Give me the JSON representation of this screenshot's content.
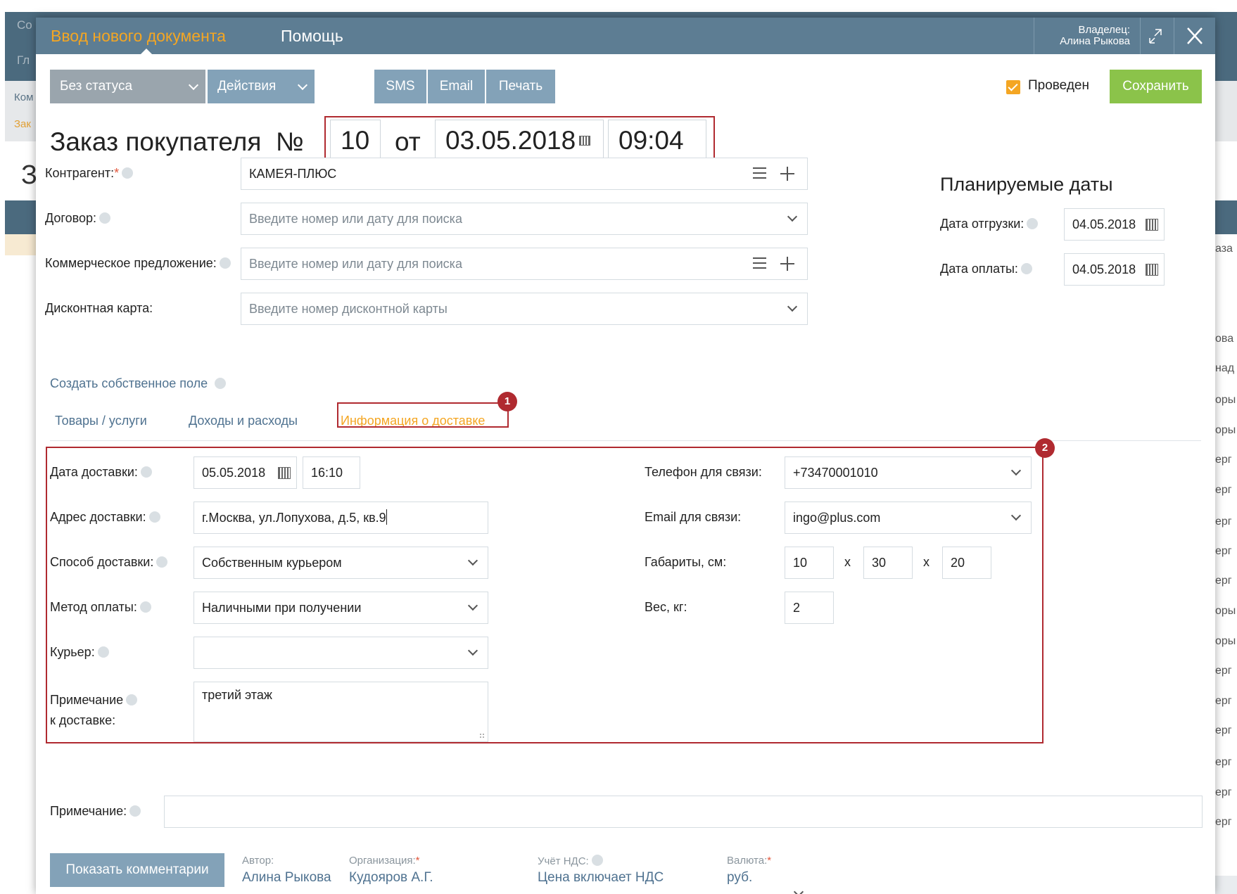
{
  "background": {
    "top_left_text_1": "Co",
    "top_left_text_2": "Гл",
    "sidebar_text_1": "Ком",
    "sidebar_text_2": "Зак",
    "big_letter": "З",
    "right_items": [
      "аза",
      "ова",
      "над",
      "оры",
      "оры",
      "ерг",
      "ерг",
      "ерг",
      "ерг",
      "ерг",
      "оры",
      "оры",
      "ерг",
      "ерг",
      "ерг",
      "ерг",
      "ерг",
      "ерг"
    ]
  },
  "header": {
    "title": "Ввод нового документа",
    "help": "Помощь",
    "owner_label": "Владелец:",
    "owner_name": "Алина Рыкова"
  },
  "toolbar": {
    "status": "Без статуса",
    "actions": "Действия",
    "sms": "SMS",
    "email": "Email",
    "print": "Печать",
    "posted_label": "Проведен",
    "posted_checked": true,
    "save": "Сохранить"
  },
  "document": {
    "title": "Заказ покупателя  №",
    "number": "10",
    "from_label": "от",
    "date": "03.05.2018",
    "time": "09:04"
  },
  "form": {
    "counterparty_label": "Контрагент:",
    "counterparty_value": "КАМЕЯ-ПЛЮС",
    "contract_label": "Договор:",
    "contract_placeholder": "Введите номер или дату для поиска",
    "offer_label": "Коммерческое предложение:",
    "offer_placeholder": "Введите номер или дату для поиска",
    "discount_label": "Дисконтная карта:",
    "discount_placeholder": "Введите номер дисконтной карты",
    "create_field_link": "Создать собственное поле"
  },
  "planned": {
    "title": "Планируемые даты",
    "shipment_label": "Дата отгрузки:",
    "shipment_date": "04.05.2018",
    "payment_label": "Дата оплаты:",
    "payment_date": "04.05.2018"
  },
  "tabs": [
    {
      "label": "Товары / услуги"
    },
    {
      "label": "Доходы и расходы"
    },
    {
      "label": "Информация о доставке",
      "active": true
    }
  ],
  "markers": {
    "first": "1",
    "second": "2"
  },
  "delivery": {
    "date_label": "Дата доставки:",
    "date": "05.05.2018",
    "time": "16:10",
    "address_label": "Адрес доставки:",
    "address": "г.Москва, ул.Лопухова, д.5, кв.9",
    "method_label": "Способ доставки:",
    "method": "Собственным курьером",
    "payment_method_label": "Метод оплаты:",
    "payment_method": "Наличными при получении",
    "courier_label": "Курьер:",
    "courier": "",
    "note_label_1": "Примечание",
    "note_label_2": "к доставке:",
    "note": "третий этаж",
    "phone_label": "Телефон для связи:",
    "phone": "+73470001010",
    "email_label": "Email для связи:",
    "email": "ingo@plus.com",
    "dimensions_label": "Габариты, см:",
    "dim_1": "10",
    "dim_2": "30",
    "dim_3": "20",
    "dim_separator": "x",
    "weight_label": "Вес, кг:",
    "weight": "2"
  },
  "note": {
    "label": "Примечание:",
    "value": ""
  },
  "footer": {
    "show_comments": "Показать комментарии",
    "author_caption": "Автор:",
    "author": "Алина Рыкова",
    "org_caption": "Организация:",
    "org": "Кудояров А.Г.",
    "vat_caption": "Учёт НДС:",
    "vat": "Цена включает НДС",
    "currency_caption": "Валюта:",
    "currency": "руб."
  },
  "colors": {
    "header_bg": "#5d7d93",
    "accent_orange": "#f4a623",
    "button_blue": "#83a2b8",
    "save_green": "#8bc34a",
    "highlight_red": "#b02a30",
    "link_blue": "#4f7290"
  }
}
